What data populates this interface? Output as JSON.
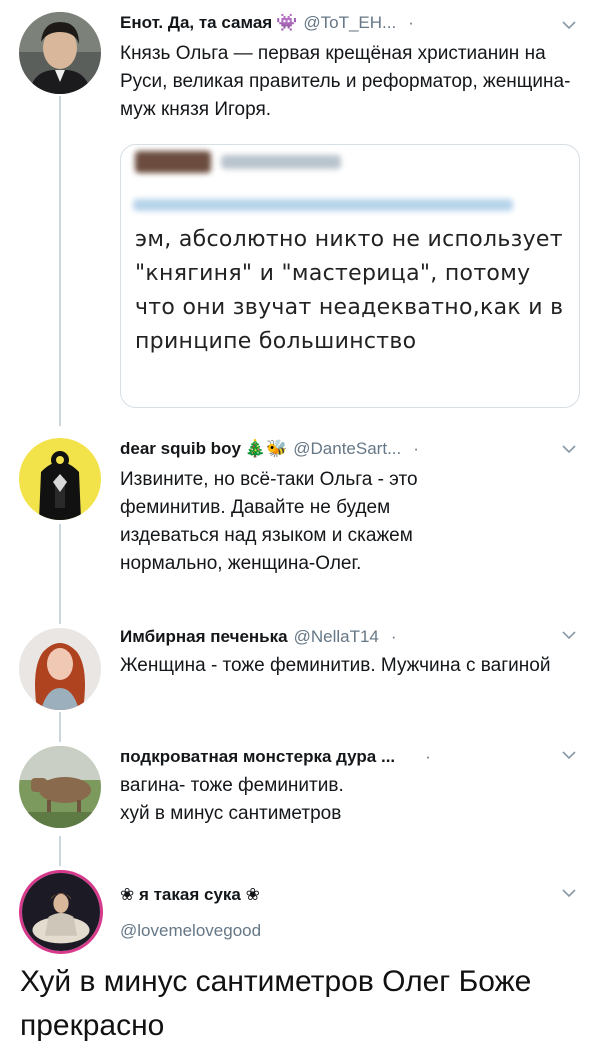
{
  "thread": [
    {
      "name": "Енот. Да, та самая",
      "emoji": "👾",
      "handle": "@ToT_EH...",
      "separator": "·",
      "text": "Князь Ольга — первая крещёная христианин на Руси, великая правитель и реформатор, женщина-муж князя Игоря.",
      "quote": {
        "text": "эм, абсолютно никто не использует \"княгиня\" и \"мастерица\", потому что они звучат неадекватно,как и в принципе большинство"
      }
    },
    {
      "name": "dear squib boy",
      "emoji": "🎄🐝",
      "handle": "@DanteSart...",
      "separator": "·",
      "text": "Извините, но всё-таки Ольга - это феминитив. Давайте не будем издеваться над языком и скажем нормально, женщина-Олег."
    },
    {
      "name": "Имбирная печенька",
      "handle": "@NellaT14",
      "separator": "·",
      "text": "Женщина - тоже феминитив. Мужчина с вагиной"
    },
    {
      "name": "подкроватная монстерка дура ...",
      "separator": "·",
      "text": "вагина- тоже феминитив.\nхуй в минус сантиметров"
    },
    {
      "name": "❀ я такая сука ❀",
      "handle": "@lovemelovegood"
    }
  ],
  "caption": "Хуй в минус сантиметров Олег Боже прекрасно",
  "colors": {
    "muted": "#657786",
    "line": "#ccd6dd",
    "text": "#14171a"
  }
}
